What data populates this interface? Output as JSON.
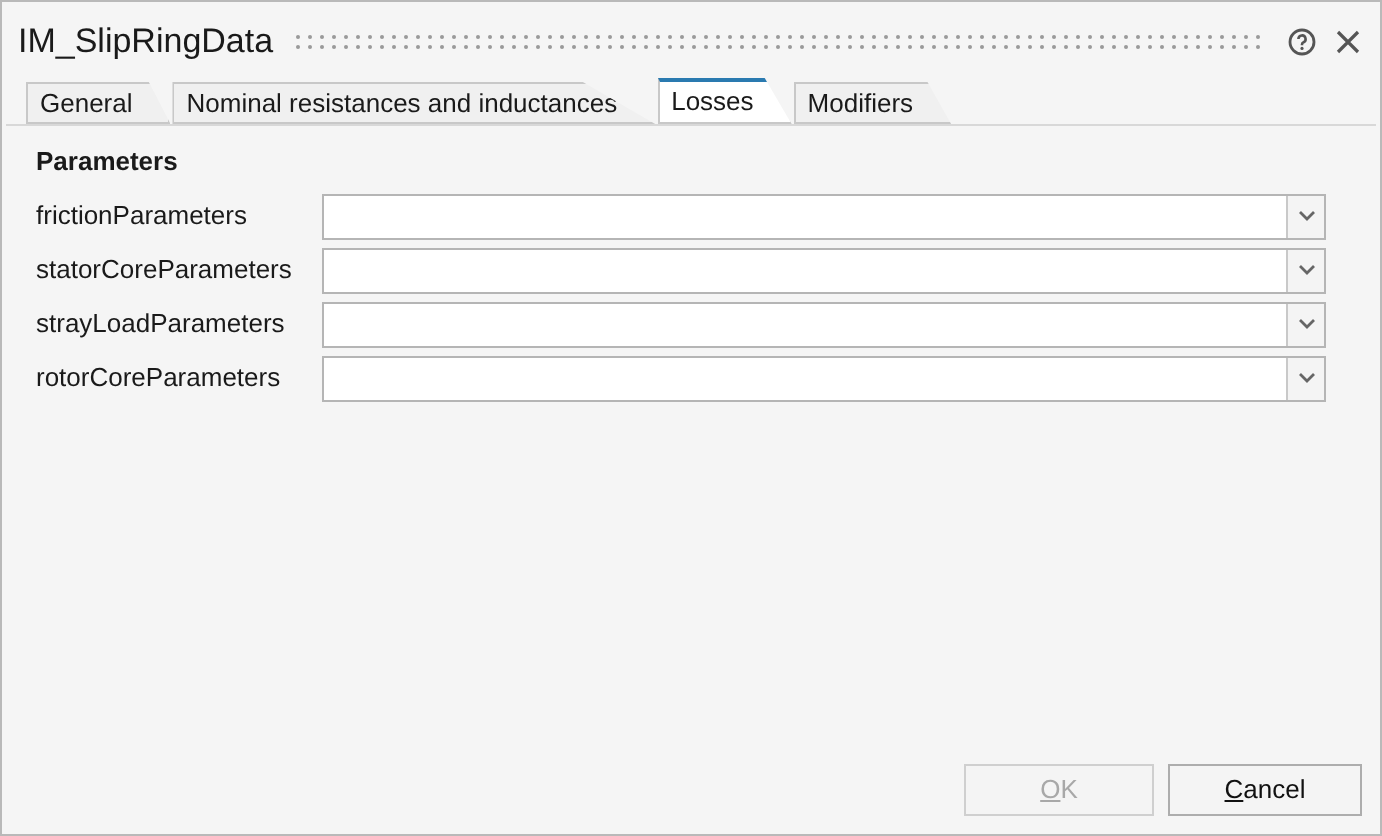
{
  "window": {
    "title": "IM_SlipRingData"
  },
  "tabs": [
    {
      "label": "General",
      "selected": false
    },
    {
      "label": "Nominal resistances and inductances",
      "selected": false
    },
    {
      "label": "Losses",
      "selected": true
    },
    {
      "label": "Modifiers",
      "selected": false
    }
  ],
  "section": {
    "title": "Parameters"
  },
  "parameters": [
    {
      "label": "frictionParameters"
    },
    {
      "label": "statorCoreParameters"
    },
    {
      "label": "strayLoadParameters"
    },
    {
      "label": "rotorCoreParameters"
    }
  ],
  "buttons": [
    {
      "label": "OK",
      "disabled": true,
      "mnemonic_underlined": true
    },
    {
      "label": "Cancel",
      "disabled": false,
      "mnemonic_underlined": true
    }
  ]
}
